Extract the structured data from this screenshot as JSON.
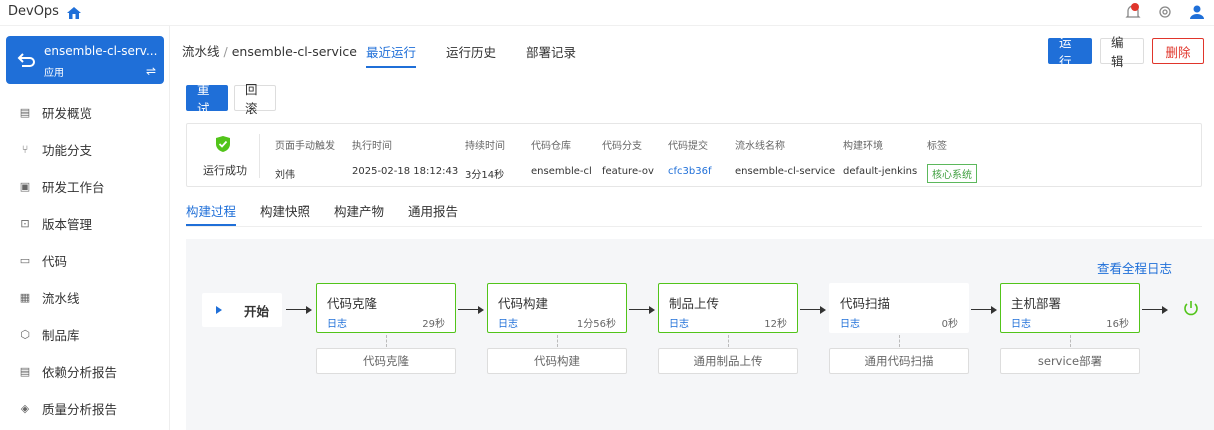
{
  "topbar": {
    "brand": "DevOps"
  },
  "app": {
    "name": "ensemble-cl-serv...",
    "type": "应用"
  },
  "nav": [
    {
      "label": "研发概览",
      "icon": "overview-icon"
    },
    {
      "label": "功能分支",
      "icon": "branch-icon"
    },
    {
      "label": "研发工作台",
      "icon": "workbench-icon"
    },
    {
      "label": "版本管理",
      "icon": "version-icon"
    },
    {
      "label": "代码",
      "icon": "code-icon"
    },
    {
      "label": "流水线",
      "icon": "pipeline-icon"
    },
    {
      "label": "制品库",
      "icon": "artifact-icon"
    },
    {
      "label": "依赖分析报告",
      "icon": "dependency-icon"
    },
    {
      "label": "质量分析报告",
      "icon": "quality-icon"
    }
  ],
  "breadcrumb": {
    "root": "流水线",
    "sep": "/",
    "current": "ensemble-cl-service"
  },
  "tabs": [
    "最近运行",
    "运行历史",
    "部署记录"
  ],
  "actions": {
    "run": "运行",
    "edit": "编辑",
    "delete": "删除"
  },
  "run_actions": {
    "retry": "重试",
    "rollback": "回滚"
  },
  "info": {
    "status": "运行成功",
    "trigger_label": "页面手动触发",
    "trigger_value": "刘伟",
    "exec_time_label": "执行时间",
    "exec_time_value": "2025-02-18 18:12:43",
    "duration_label": "持续时间",
    "duration_value": "3分14秒",
    "repo_label": "代码仓库",
    "repo_value": "ensemble-cl",
    "branch_label": "代码分支",
    "branch_value": "feature-ov",
    "commit_label": "代码提交",
    "commit_value": "cfc3b36f",
    "pipeline_label": "流水线名称",
    "pipeline_value": "ensemble-cl-service",
    "env_label": "构建环境",
    "env_value": "default-jenkins",
    "tag_label": "标签",
    "tag_value": "核心系统"
  },
  "subtabs": [
    "构建过程",
    "构建快照",
    "构建产物",
    "通用报告"
  ],
  "canvas": {
    "full_log": "查看全程日志",
    "start": "开始",
    "stages": [
      {
        "title": "代码克隆",
        "log": "日志",
        "duration": "29秒",
        "job": "代码克隆",
        "ok": true
      },
      {
        "title": "代码构建",
        "log": "日志",
        "duration": "1分56秒",
        "job": "代码构建",
        "ok": true
      },
      {
        "title": "制品上传",
        "log": "日志",
        "duration": "12秒",
        "job": "通用制品上传",
        "ok": true
      },
      {
        "title": "代码扫描",
        "log": "日志",
        "duration": "0秒",
        "job": "通用代码扫描",
        "ok": false
      },
      {
        "title": "主机部署",
        "log": "日志",
        "duration": "16秒",
        "job": "service部署",
        "ok": true
      }
    ]
  },
  "colors": {
    "primary": "#1f6fd8",
    "success": "#52c41a",
    "danger": "#e0352b"
  }
}
